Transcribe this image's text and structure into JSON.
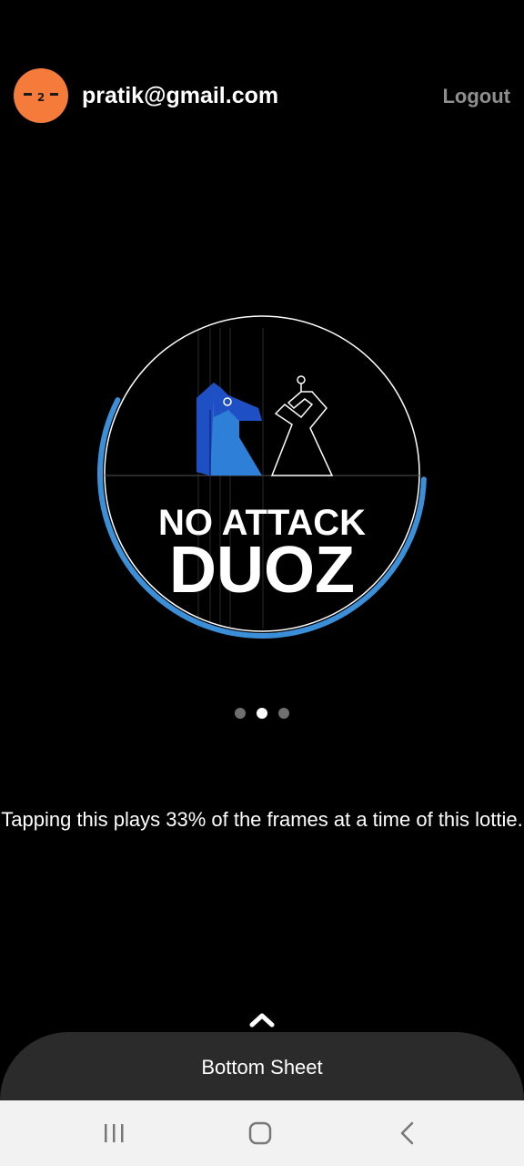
{
  "header": {
    "avatar_text": "-2-",
    "email": "pratik@gmail.com",
    "logout_label": "Logout"
  },
  "logo": {
    "line1": "NO ATTACK",
    "line2": "DUOZ",
    "progress": 0.33
  },
  "pager": {
    "count": 3,
    "active_index": 1
  },
  "description": "Tapping this plays 33% of the frames at a time of this lottie.",
  "bottom_sheet": {
    "label": "Bottom Sheet"
  },
  "colors": {
    "avatar": "#f47b3a",
    "ring_accent": "#3b8fd9",
    "knight_dark": "#1f4fc4",
    "knight_light": "#2d7fd8",
    "sheet": "#2b2b2b",
    "navbar": "#f2f2f2"
  },
  "icons": {
    "expand": "chevron-up-icon",
    "nav_recents": "recents-icon",
    "nav_home": "home-icon",
    "nav_back": "back-icon"
  }
}
